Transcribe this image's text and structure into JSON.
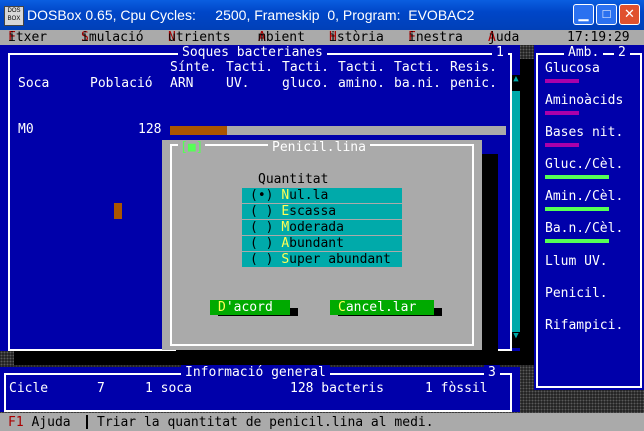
{
  "window": {
    "title": "DOSBox 0.65, Cpu Cycles:     2500, Frameskip  0, Program:  EVOBAC2",
    "icon_label": "DOS BOX",
    "minimize_icon": "minimize-icon",
    "maximize_icon": "maximize-icon",
    "close_icon": "close-icon"
  },
  "menu": {
    "items": [
      {
        "hk": "F",
        "rest": "itxer"
      },
      {
        "hk": "S",
        "rest": "imulació"
      },
      {
        "hk": "N",
        "rest": "utrients"
      },
      {
        "hk": "A",
        "rest": "mbient"
      },
      {
        "hk": "H",
        "rest": "istòria"
      },
      {
        "hk": "F",
        "rest": "inestra"
      },
      {
        "hk": "A",
        "rest": "juda"
      }
    ],
    "clock": "17:19:29"
  },
  "strains": {
    "title": "Soques bacterianes",
    "number": "1",
    "col1": "Soca",
    "col2": "Població",
    "h1a": "Sínte.",
    "h1b": "ARN",
    "h2a": "Tacti.",
    "h2b": "UV.",
    "h3a": "Tacti.",
    "h3b": "gluco.",
    "h4a": "Tacti.",
    "h4b": "amino.",
    "h5a": "Tacti.",
    "h5b": "ba.ni.",
    "h6a": "Resis.",
    "h6b": "penic.",
    "row_name": "M0",
    "row_population": "128",
    "population_fill": 0.17
  },
  "environment": {
    "title": "Amb.",
    "number": "2",
    "items": [
      "Glucosa",
      "Aminoàcids",
      "Bases nit.",
      "Gluc./Cèl.",
      "Amin./Cèl.",
      "Ba.n./Cèl.",
      "Llum UV.",
      "Penicil.",
      "Rifampici."
    ],
    "colors": {
      "magenta": "#aa00aa",
      "green": "#55ff55"
    }
  },
  "info": {
    "title": "Informació general",
    "number": "3",
    "cycle_label": "Cicle",
    "cycle_value": "7",
    "soca": "1 soca",
    "bacteris": "128 bacteris",
    "fossil": "1 fòssil"
  },
  "dialog": {
    "title": "Penicil.lina",
    "close_glyph": "[■]",
    "group_label": "Quantitat",
    "options": [
      {
        "mark": "(•) ",
        "hk": "N",
        "rest": "ul.la",
        "selected": true
      },
      {
        "mark": "( ) ",
        "hk": "E",
        "rest": "scassa",
        "selected": false
      },
      {
        "mark": "( ) ",
        "hk": "M",
        "rest": "oderada",
        "selected": false
      },
      {
        "mark": "( ) ",
        "hk": "A",
        "rest": "bundant",
        "selected": false
      },
      {
        "mark": "( ) ",
        "hk": "S",
        "rest": "uper abundant",
        "selected": false
      }
    ],
    "ok_hk": "D",
    "ok_rest": "'acord",
    "cancel_hk": "C",
    "cancel_rest": "ancel.lar"
  },
  "status": {
    "key": "F1",
    "key_label": " Ajuda",
    "message": "Triar la quantitat de penicil.lina al medi."
  },
  "colors": {
    "dos_blue": "#0000aa",
    "dos_gray": "#aaaaaa",
    "dos_cyan": "#00aaaa",
    "dos_green": "#00aa00",
    "bar_fill": "#aa5500"
  }
}
